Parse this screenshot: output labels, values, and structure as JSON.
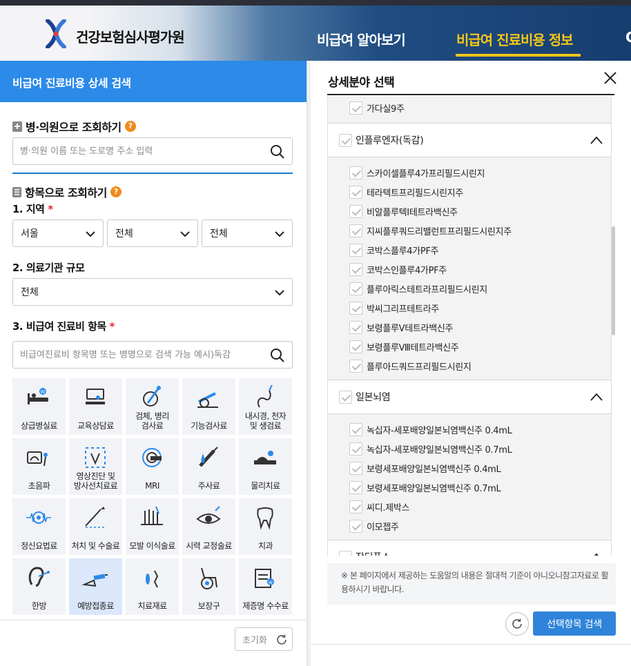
{
  "header": {
    "brand": "건강보험심사평가원",
    "nav": [
      "비급여 알아보기",
      "비급여 진료비용 정보",
      "C"
    ],
    "active_nav_color": "#f5c518"
  },
  "left": {
    "panel_title": "비급여 진료비용 상세 검색",
    "hospital_search": {
      "title": "병·의원으로 조회하기",
      "help": "?",
      "placeholder": "병·의원 이름 또는 도로명 주소 입력"
    },
    "item_search": {
      "title": "항목으로 조회하기",
      "help": "?",
      "region_label": "1. 지역",
      "region_req": "*",
      "region_values": [
        "서울",
        "전체",
        "전체"
      ],
      "scale_label": "2. 의료기관 규모",
      "scale_value": "전체",
      "item_label": "3. 비급여 진료비 항목",
      "item_req": "*",
      "item_placeholder": "비급여진료비 항목명 또는 병명으로 검색 가능 예시)독감"
    },
    "categories": [
      {
        "label": "상급병실료",
        "icon": "hospital-bed-icon"
      },
      {
        "label": "교육상담료",
        "icon": "consultation-icon"
      },
      {
        "label": "검체, 병리\n검사료",
        "icon": "specimen-test-icon"
      },
      {
        "label": "기능검사료",
        "icon": "function-test-icon"
      },
      {
        "label": "내시경, 천자\n및 생검료",
        "icon": "endoscope-icon"
      },
      {
        "label": "초음파",
        "icon": "ultrasound-icon"
      },
      {
        "label": "영상진단 및\n방사선치료료",
        "icon": "radiology-icon"
      },
      {
        "label": "MRI",
        "icon": "mri-icon"
      },
      {
        "label": "주사료",
        "icon": "syringe-icon"
      },
      {
        "label": "물리치료",
        "icon": "physical-therapy-icon"
      },
      {
        "label": "정신요법료",
        "icon": "psychotherapy-icon"
      },
      {
        "label": "처치 및 수술료",
        "icon": "surgery-icon"
      },
      {
        "label": "모발 이식술료",
        "icon": "hair-transplant-icon"
      },
      {
        "label": "시력 교정술료",
        "icon": "eye-correction-icon"
      },
      {
        "label": "치과",
        "icon": "tooth-icon"
      },
      {
        "label": "한방",
        "icon": "oriental-medicine-icon"
      },
      {
        "label": "예방접종료",
        "icon": "vaccination-icon"
      },
      {
        "label": "치료재료",
        "icon": "treatment-material-icon"
      },
      {
        "label": "보장구",
        "icon": "wheelchair-icon"
      },
      {
        "label": "제증명 수수료",
        "icon": "certificate-icon"
      }
    ],
    "active_category": "예방접종료",
    "reset_label": "초기화"
  },
  "right": {
    "title": "상세분야 선택",
    "prev_item": "가다실9주",
    "groups": [
      {
        "name": "인플루엔자(독감)",
        "items": [
          "스카이셀플루4가프리필드시린지",
          "테라텍트프리필드시린지주",
          "비알플루텍I테트라백신주",
          "지씨플루쿼드리밸런트프리필드시린지주",
          "코박스플루4가PF주",
          "코박스인플루4가PF주",
          "플루아릭스테트라프리필드시린지",
          "박씨그리프테트라주",
          "보령플루Ⅴ테트라백신주",
          "보령플루Ⅷ테트라백신주",
          "플루아드쿼드프리필드시린지"
        ]
      },
      {
        "name": "일본뇌염",
        "items": [
          "녹십자-세포배양일본뇌염백신주 0.4mL",
          "녹십자-세포배양일본뇌염백신주 0.7mL",
          "보령세포배양일본뇌염백신주 0.4mL",
          "보령세포배양일본뇌염백신주 0.7mL",
          "씨디.제박스",
          "이모젭주"
        ]
      },
      {
        "name": "장티푸스",
        "items": []
      }
    ],
    "notice": "※ 본 페이지에서 제공하는 도움말의 내용은 절대적 기준이 아니오니참고자료로 활용하시기 바랍니다.",
    "search_button": "선택항목 검색",
    "button_color": "#2f84d9"
  }
}
